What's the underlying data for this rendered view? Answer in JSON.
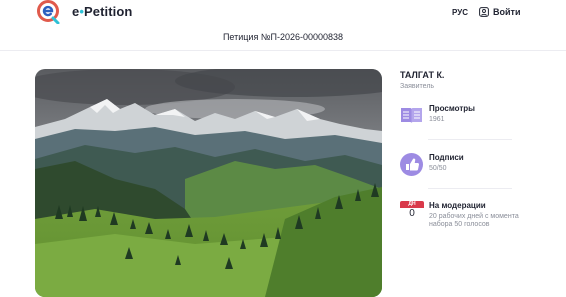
{
  "header": {
    "brand_e": "e",
    "brand_dot": "•",
    "brand_rest": "Petition",
    "lang": "РУС",
    "login_label": "Войти"
  },
  "petition": {
    "title": "Петиция №П-2026-00000838"
  },
  "author": {
    "name": "ТАЛГАТ К.",
    "role": "Заявитель"
  },
  "stats": {
    "views": {
      "label": "Просмотры",
      "value": "1961",
      "icon": "book-icon"
    },
    "signatures": {
      "label": "Подписи",
      "value": "50/50",
      "icon": "thumbs-up-icon"
    },
    "moderation": {
      "cal_head": "ДН",
      "cal_num": "0",
      "label": "На модерации",
      "desc": "20 рабочих дней с момента набора 50 голосов",
      "icon": "calendar-icon"
    }
  },
  "colors": {
    "accent_purple": "#9d8be3",
    "accent_cyan": "#2ec1d6",
    "brand_red": "#e05a4c",
    "calendar_red": "#d9394a"
  }
}
